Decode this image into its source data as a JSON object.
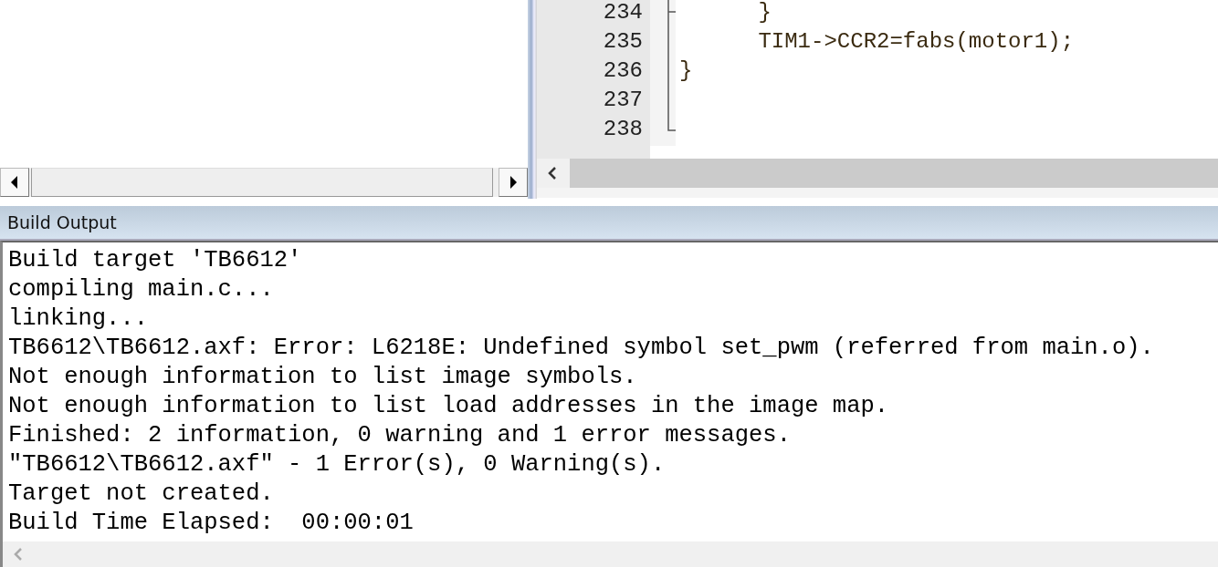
{
  "editor": {
    "lines": [
      {
        "number": "234",
        "code": "      }"
      },
      {
        "number": "235",
        "code": "      TIM1->CCR2=fabs(motor1);"
      },
      {
        "number": "236",
        "code": "}"
      },
      {
        "number": "237"
      },
      {
        "number": "238"
      }
    ]
  },
  "build_output": {
    "title": "Build Output",
    "lines": [
      "Build target 'TB6612'",
      "compiling main.c...",
      "linking...",
      "TB6612\\TB6612.axf: Error: L6218E: Undefined symbol set_pwm (referred from main.o).",
      "Not enough information to list image symbols.",
      "Not enough information to list load addresses in the image map.",
      "Finished: 2 information, 0 warning and 1 error messages.",
      "\"TB6612\\TB6612.axf\" - 1 Error(s), 0 Warning(s).",
      "Target not created.",
      "Build Time Elapsed:  00:00:01"
    ]
  }
}
